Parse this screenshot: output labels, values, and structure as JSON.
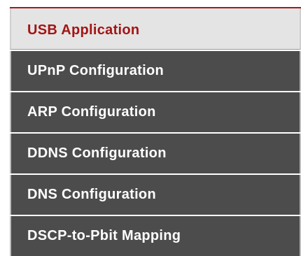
{
  "menu": {
    "items": [
      {
        "label": "USB Application",
        "active": true
      },
      {
        "label": "UPnP Configuration",
        "active": false
      },
      {
        "label": "ARP Configuration",
        "active": false
      },
      {
        "label": "DDNS Configuration",
        "active": false
      },
      {
        "label": "DNS Configuration",
        "active": false
      },
      {
        "label": "DSCP-to-Pbit Mapping",
        "active": false
      }
    ]
  },
  "colors": {
    "accent": "#a31515",
    "item_bg": "#4c4c4c",
    "active_bg": "#e4e4e4"
  }
}
